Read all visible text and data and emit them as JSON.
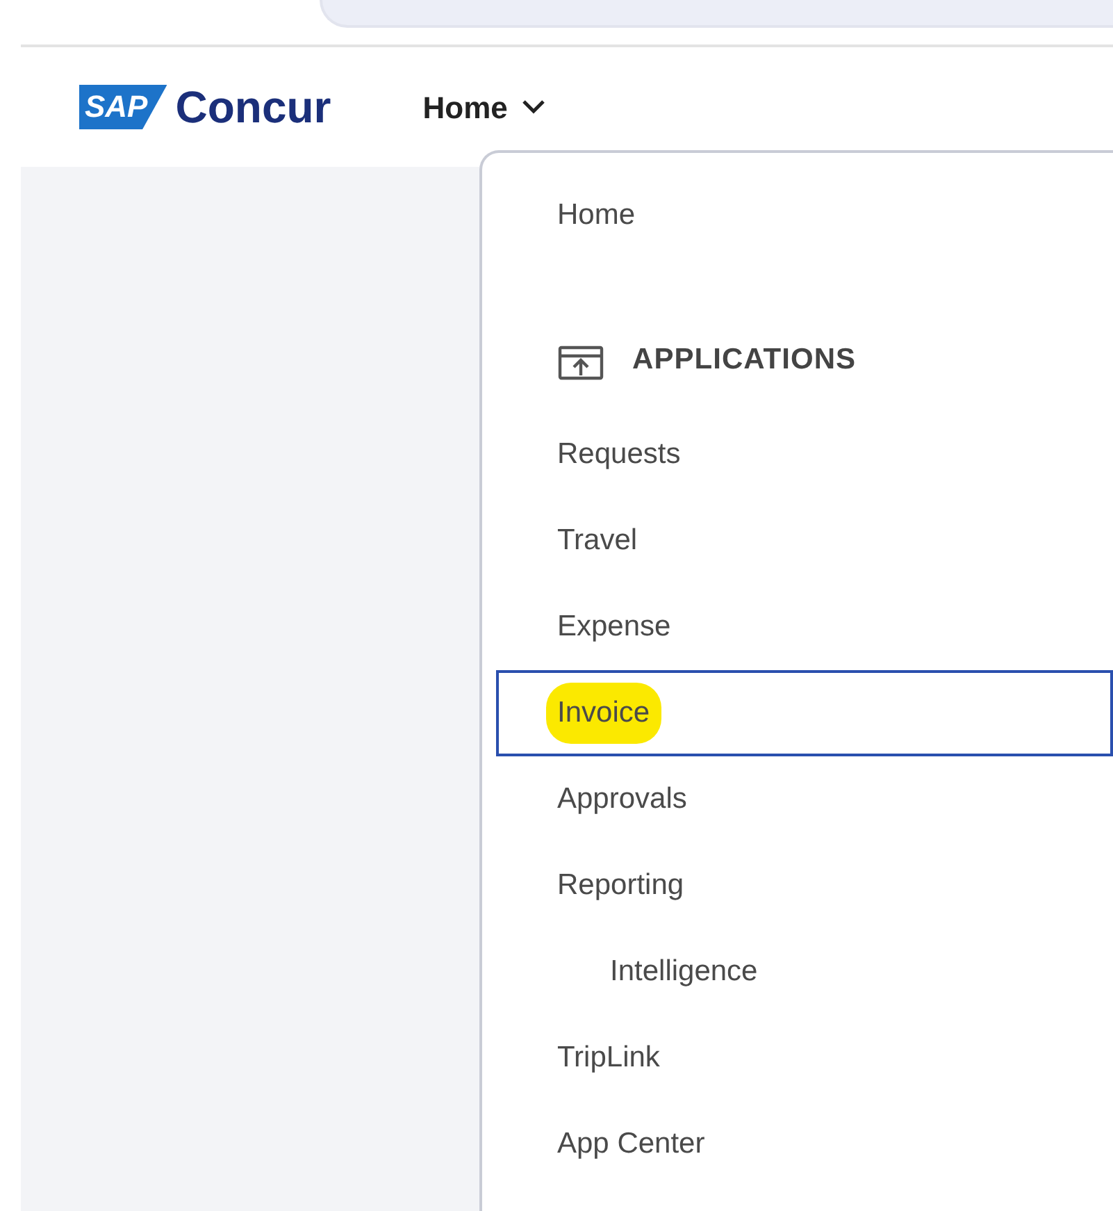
{
  "header": {
    "logo": {
      "mark": "SAP",
      "name": "Concur"
    },
    "nav": {
      "label": "Home",
      "expanded": true
    }
  },
  "menu": {
    "items": [
      {
        "kind": "link",
        "label": "Home",
        "selected": false,
        "highlighted": false
      },
      {
        "kind": "heading",
        "label": "APPLICATIONS"
      },
      {
        "kind": "link",
        "label": "Requests",
        "selected": false,
        "highlighted": false
      },
      {
        "kind": "link",
        "label": "Travel",
        "selected": false,
        "highlighted": false
      },
      {
        "kind": "link",
        "label": "Expense",
        "selected": false,
        "highlighted": false
      },
      {
        "kind": "link",
        "label": "Invoice",
        "selected": true,
        "highlighted": true
      },
      {
        "kind": "link",
        "label": "Approvals",
        "selected": false,
        "highlighted": false
      },
      {
        "kind": "link",
        "label": "Reporting",
        "selected": false,
        "highlighted": false,
        "children": [
          {
            "kind": "link",
            "label": "Intelligence",
            "selected": false,
            "highlighted": false
          }
        ]
      },
      {
        "kind": "link",
        "label": "TripLink",
        "selected": false,
        "highlighted": false
      },
      {
        "kind": "link",
        "label": "App Center",
        "selected": false,
        "highlighted": false
      }
    ]
  }
}
